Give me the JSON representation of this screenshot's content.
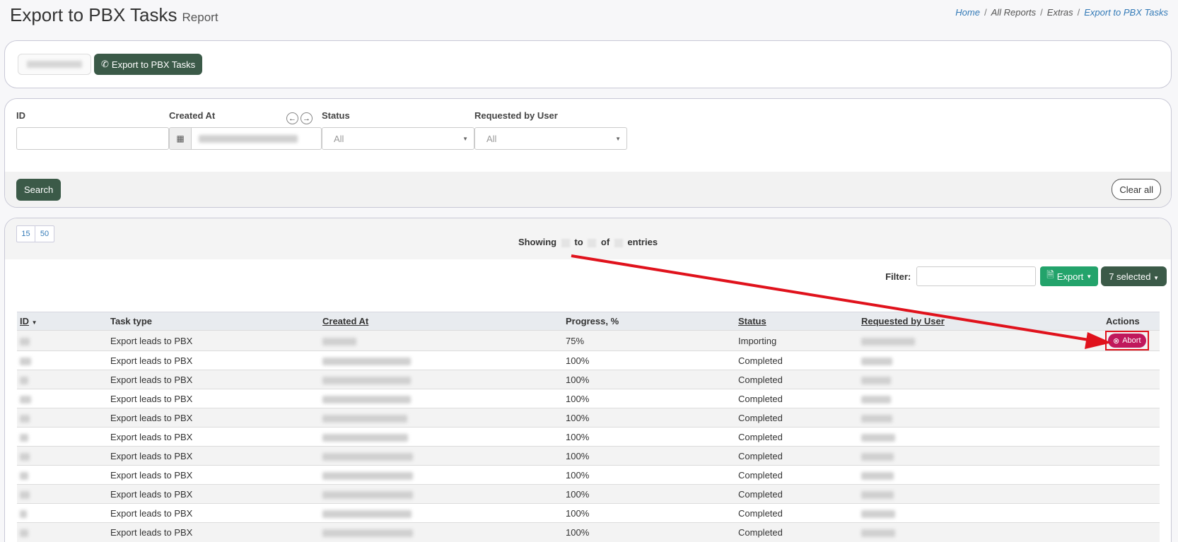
{
  "header": {
    "title": "Export to PBX Tasks",
    "subtitle": "Report",
    "breadcrumb": [
      "Home",
      "All Reports",
      "Extras",
      "Export to PBX Tasks"
    ]
  },
  "tabs": {
    "pbx_label": "Export to PBX Tasks"
  },
  "filters": {
    "id_label": "ID",
    "created_label": "Created At",
    "status_label": "Status",
    "status_value": "All",
    "user_label": "Requested by User",
    "user_value": "All",
    "search_label": "Search",
    "clear_label": "Clear all"
  },
  "table": {
    "page_sizes": [
      "15",
      "50"
    ],
    "showing_prefix": "Showing",
    "showing_to": "to",
    "showing_of": "of",
    "showing_suffix": "entries",
    "filter_label": "Filter:",
    "export_label": "Export",
    "selected_label": "7 selected",
    "columns": [
      "ID",
      "Task type",
      "Created At",
      "Progress, %",
      "Status",
      "Requested by User",
      "Actions"
    ],
    "abort_label": "Abort",
    "rows": [
      {
        "task": "Export leads to PBX",
        "progress": "75%",
        "status": "Importing"
      },
      {
        "task": "Export leads to PBX",
        "progress": "100%",
        "status": "Completed"
      },
      {
        "task": "Export leads to PBX",
        "progress": "100%",
        "status": "Completed"
      },
      {
        "task": "Export leads to PBX",
        "progress": "100%",
        "status": "Completed"
      },
      {
        "task": "Export leads to PBX",
        "progress": "100%",
        "status": "Completed"
      },
      {
        "task": "Export leads to PBX",
        "progress": "100%",
        "status": "Completed"
      },
      {
        "task": "Export leads to PBX",
        "progress": "100%",
        "status": "Completed"
      },
      {
        "task": "Export leads to PBX",
        "progress": "100%",
        "status": "Completed"
      },
      {
        "task": "Export leads to PBX",
        "progress": "100%",
        "status": "Completed"
      },
      {
        "task": "Export leads to PBX",
        "progress": "100%",
        "status": "Completed"
      },
      {
        "task": "Export leads to PBX",
        "progress": "100%",
        "status": "Completed"
      }
    ]
  },
  "colors": {
    "primary_dark": "#3b5a48",
    "export_green": "#23a36b",
    "abort": "#c0185c",
    "annotation_red": "#e0121c",
    "link": "#337ab7"
  }
}
